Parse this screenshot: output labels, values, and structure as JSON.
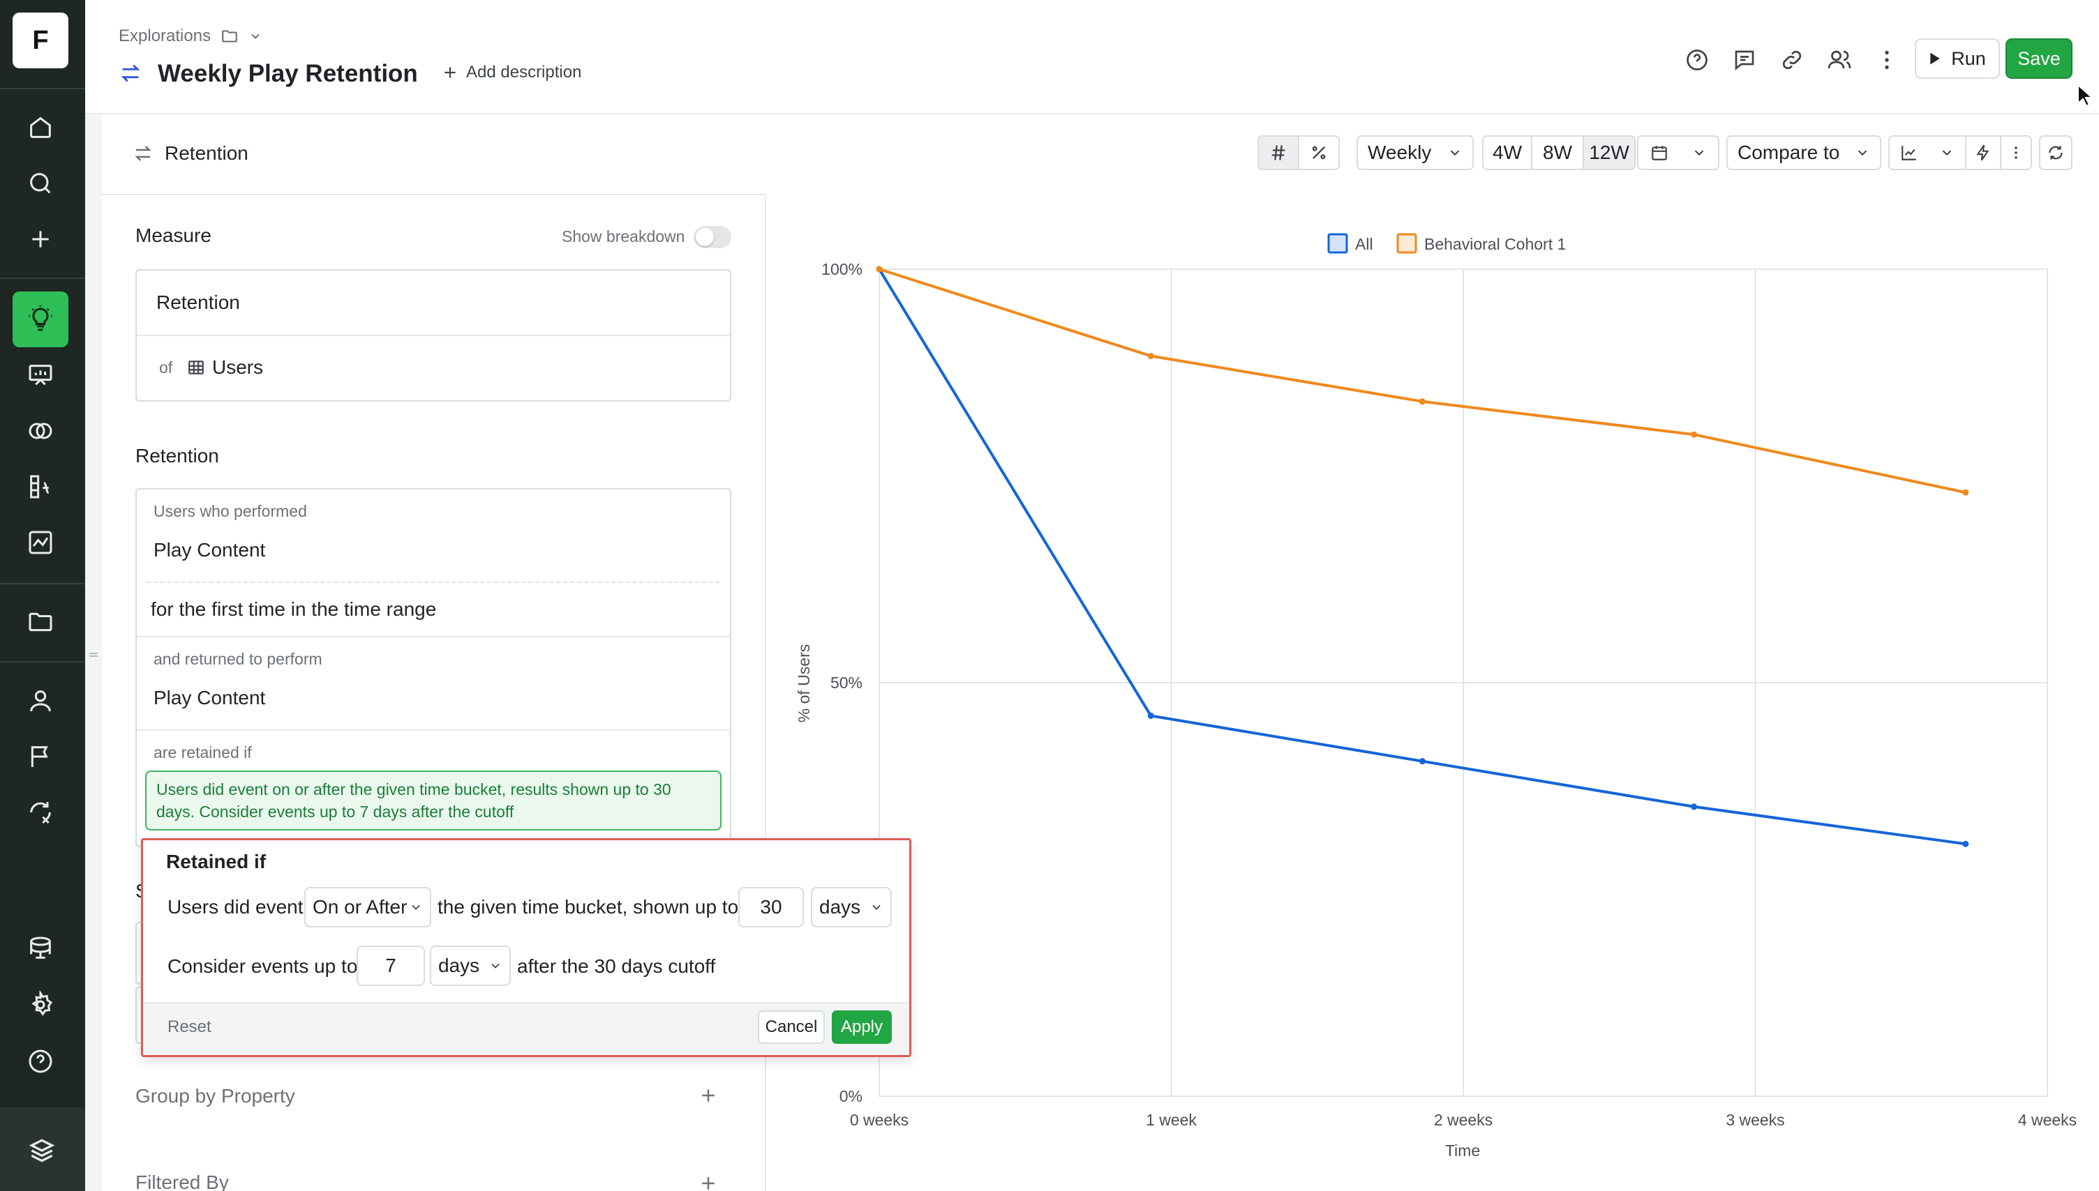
{
  "app": {
    "logo_letter": "F",
    "breadcrumb": "Explorations",
    "title": "Weekly Play Retention",
    "add_description": "Add description",
    "run_label": "Run",
    "save_label": "Save",
    "accent_color": "#22a543"
  },
  "rail": {
    "items": [
      "home-icon",
      "search-icon",
      "plus-icon",
      "lightbulb-icon",
      "presentation-icon",
      "overlap-icon",
      "formula-icon",
      "chart-icon",
      "folder-icon",
      "user-icon",
      "flag-icon",
      "experiment-icon",
      "database-icon",
      "settings-icon",
      "help-icon"
    ],
    "active": "lightbulb-icon"
  },
  "panel": {
    "header": "Retention",
    "measure_title": "Measure",
    "show_breakdown": "Show breakdown",
    "measure_metric": "Retention",
    "measure_of": "of",
    "measure_entity": "Users",
    "retention_title": "Retention",
    "users_who_performed": "Users who performed",
    "first_event": "Play Content",
    "first_time": "for the first time in the time range",
    "returned_label": "and returned to perform",
    "return_event": "Play Content",
    "retained_if_label": "are retained if",
    "retained_summary_1": "Users did event on or after the given time bucket, results shown up to 30",
    "retained_summary_2": "days. Consider events up to 7 days after the cutoff",
    "s_partial": "S",
    "group_by": "Group by Property",
    "filtered_by": "Filtered By"
  },
  "popover": {
    "title": "Retained if",
    "row1_prefix": "Users did event",
    "row1_mode": "On or After",
    "row1_mid": "the given time bucket, shown up to",
    "row1_value": "30",
    "row1_unit": "days",
    "row2_prefix": "Consider events up to",
    "row2_value": "7",
    "row2_unit": "days",
    "row2_suffix": "after the 30 days cutoff",
    "reset": "Reset",
    "cancel": "Cancel",
    "apply": "Apply"
  },
  "toolbar": {
    "hash_icon": "hash-icon",
    "percent_icon": "percent-icon",
    "interval": "Weekly",
    "ranges": [
      "4W",
      "8W",
      "12W"
    ],
    "selected_range": "12W",
    "compare_to": "Compare to"
  },
  "chart_data": {
    "type": "line",
    "title": "",
    "xlabel": "Time",
    "ylabel": "% of Users",
    "x_ticks": [
      "0 weeks",
      "1 week",
      "2 weeks",
      "3 weeks",
      "4 weeks"
    ],
    "y_ticks": [
      "0%",
      "50%",
      "100%"
    ],
    "xlim": [
      0,
      4
    ],
    "ylim": [
      0,
      100
    ],
    "grid": true,
    "legend_position": "top-center",
    "series": [
      {
        "name": "All",
        "color": "#1565d8",
        "x": [
          0,
          0.93,
          1.86,
          2.79,
          3.72
        ],
        "y": [
          100,
          46,
          40.5,
          35,
          30.5
        ]
      },
      {
        "name": "Behavioral Cohort 1",
        "color": "#f0891c",
        "x": [
          0,
          0.93,
          1.86,
          2.79,
          3.72
        ],
        "y": [
          100,
          89.5,
          84,
          80,
          73
        ]
      }
    ]
  }
}
